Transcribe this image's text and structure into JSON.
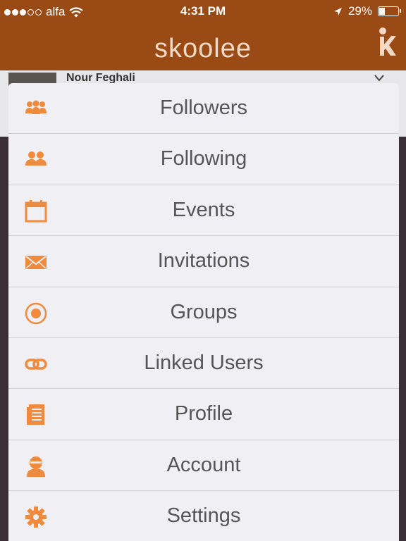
{
  "status_bar": {
    "carrier": "alfa",
    "time": "4:31 PM",
    "battery_text": "29%",
    "battery_level": 0.29
  },
  "header": {
    "logo_text": "skoolee"
  },
  "background_header": {
    "user_name": "Nour Feghali"
  },
  "menu": {
    "items": [
      {
        "label": "Followers",
        "icon": "followers-icon"
      },
      {
        "label": "Following",
        "icon": "following-icon"
      },
      {
        "label": "Events",
        "icon": "calendar-icon"
      },
      {
        "label": "Invitations",
        "icon": "envelope-icon"
      },
      {
        "label": "Groups",
        "icon": "target-icon"
      },
      {
        "label": "Linked Users",
        "icon": "link-icon"
      },
      {
        "label": "Profile",
        "icon": "document-icon"
      },
      {
        "label": "Account",
        "icon": "user-icon"
      },
      {
        "label": "Settings",
        "icon": "gear-icon"
      }
    ]
  },
  "colors": {
    "brand": "#9a4a15",
    "icon": "#f08a3c",
    "menu_bg": "#efeff4",
    "text": "#555555"
  }
}
